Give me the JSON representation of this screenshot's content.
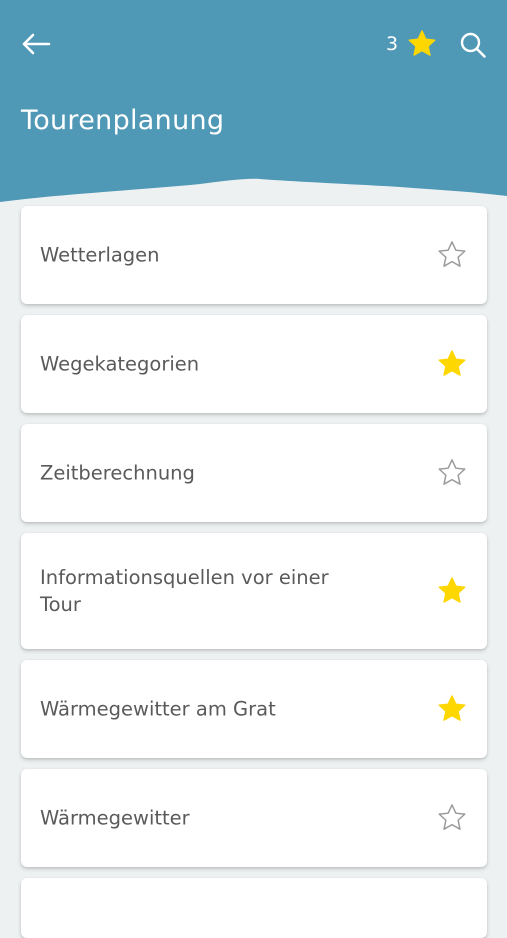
{
  "header": {
    "title": "Tourenplanung",
    "favorite_count": "3",
    "back_icon": "arrow-left-icon",
    "favorites_icon": "star-filled-icon",
    "search_icon": "search-icon"
  },
  "colors": {
    "header_bg": "#4f98b6",
    "page_bg": "#edf1f2",
    "star_filled": "#fed600",
    "star_outline": "#9a9a9a",
    "text": "#5a5a5a"
  },
  "topics": [
    {
      "label": "Wetterlagen",
      "favorite": false
    },
    {
      "label": "Wegekategorien",
      "favorite": true
    },
    {
      "label": "Zeitberechnung",
      "favorite": false
    },
    {
      "label": "Informationsquellen vor einer Tour",
      "favorite": true
    },
    {
      "label": "Wärmegewitter am Grat",
      "favorite": true
    },
    {
      "label": "Wärmegewitter",
      "favorite": false
    }
  ]
}
